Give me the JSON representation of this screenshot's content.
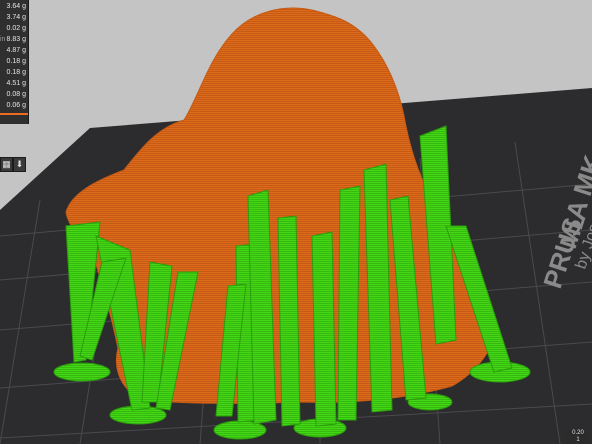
{
  "stats": [
    {
      "label": "",
      "value": "3.64 g"
    },
    {
      "label": "",
      "value": "3.74 g"
    },
    {
      "label": "",
      "value": "0.02 g"
    },
    {
      "label": "in",
      "value": "8.83 g"
    },
    {
      "label": "",
      "value": "4.87 g"
    },
    {
      "label": "",
      "value": "0.18 g"
    },
    {
      "label": "",
      "value": "0.18 g"
    },
    {
      "label": "",
      "value": "4.51 g"
    },
    {
      "label": "",
      "value": "0.08 g"
    },
    {
      "label": "",
      "value": "0.06 g"
    }
  ],
  "bed_branding": {
    "line1": "PRUSA MK",
    "line2": "by Josef Prusa",
    "edge": "ML"
  },
  "layer_readout": {
    "line1": "0.20",
    "line2": "1"
  },
  "toolbar": {
    "cube_icon": "cube-icon",
    "export_icon": "export-icon"
  },
  "colors": {
    "model": "#e06a1a",
    "supports": "#3fd414",
    "bed": "#2c2c2e",
    "panel": "#2f2f2f",
    "accent": "#ed6b21"
  }
}
